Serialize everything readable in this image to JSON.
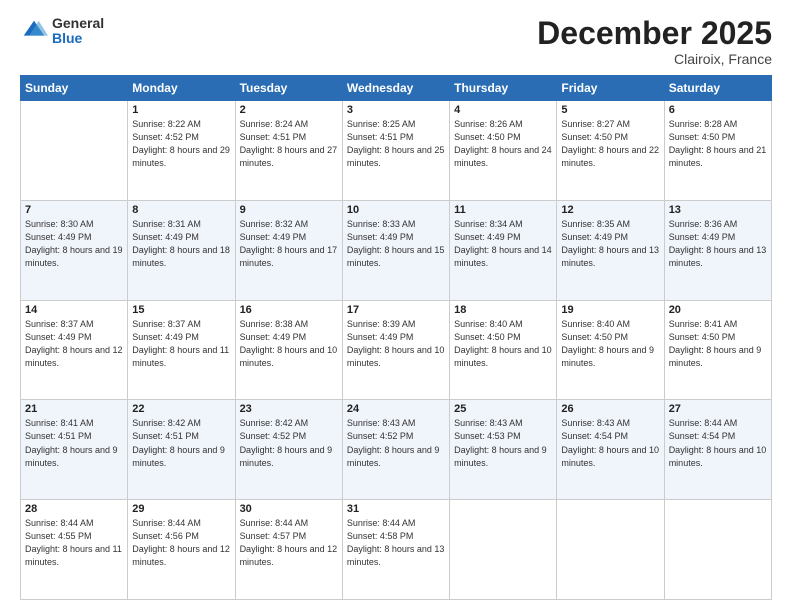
{
  "header": {
    "logo_general": "General",
    "logo_blue": "Blue",
    "month": "December 2025",
    "location": "Clairoix, France"
  },
  "days_of_week": [
    "Sunday",
    "Monday",
    "Tuesday",
    "Wednesday",
    "Thursday",
    "Friday",
    "Saturday"
  ],
  "weeks": [
    [
      {
        "day": "",
        "sunrise": "",
        "sunset": "",
        "daylight": "",
        "empty": true
      },
      {
        "day": "1",
        "sunrise": "Sunrise: 8:22 AM",
        "sunset": "Sunset: 4:52 PM",
        "daylight": "Daylight: 8 hours and 29 minutes."
      },
      {
        "day": "2",
        "sunrise": "Sunrise: 8:24 AM",
        "sunset": "Sunset: 4:51 PM",
        "daylight": "Daylight: 8 hours and 27 minutes."
      },
      {
        "day": "3",
        "sunrise": "Sunrise: 8:25 AM",
        "sunset": "Sunset: 4:51 PM",
        "daylight": "Daylight: 8 hours and 25 minutes."
      },
      {
        "day": "4",
        "sunrise": "Sunrise: 8:26 AM",
        "sunset": "Sunset: 4:50 PM",
        "daylight": "Daylight: 8 hours and 24 minutes."
      },
      {
        "day": "5",
        "sunrise": "Sunrise: 8:27 AM",
        "sunset": "Sunset: 4:50 PM",
        "daylight": "Daylight: 8 hours and 22 minutes."
      },
      {
        "day": "6",
        "sunrise": "Sunrise: 8:28 AM",
        "sunset": "Sunset: 4:50 PM",
        "daylight": "Daylight: 8 hours and 21 minutes."
      }
    ],
    [
      {
        "day": "7",
        "sunrise": "Sunrise: 8:30 AM",
        "sunset": "Sunset: 4:49 PM",
        "daylight": "Daylight: 8 hours and 19 minutes."
      },
      {
        "day": "8",
        "sunrise": "Sunrise: 8:31 AM",
        "sunset": "Sunset: 4:49 PM",
        "daylight": "Daylight: 8 hours and 18 minutes."
      },
      {
        "day": "9",
        "sunrise": "Sunrise: 8:32 AM",
        "sunset": "Sunset: 4:49 PM",
        "daylight": "Daylight: 8 hours and 17 minutes."
      },
      {
        "day": "10",
        "sunrise": "Sunrise: 8:33 AM",
        "sunset": "Sunset: 4:49 PM",
        "daylight": "Daylight: 8 hours and 15 minutes."
      },
      {
        "day": "11",
        "sunrise": "Sunrise: 8:34 AM",
        "sunset": "Sunset: 4:49 PM",
        "daylight": "Daylight: 8 hours and 14 minutes."
      },
      {
        "day": "12",
        "sunrise": "Sunrise: 8:35 AM",
        "sunset": "Sunset: 4:49 PM",
        "daylight": "Daylight: 8 hours and 13 minutes."
      },
      {
        "day": "13",
        "sunrise": "Sunrise: 8:36 AM",
        "sunset": "Sunset: 4:49 PM",
        "daylight": "Daylight: 8 hours and 13 minutes."
      }
    ],
    [
      {
        "day": "14",
        "sunrise": "Sunrise: 8:37 AM",
        "sunset": "Sunset: 4:49 PM",
        "daylight": "Daylight: 8 hours and 12 minutes."
      },
      {
        "day": "15",
        "sunrise": "Sunrise: 8:37 AM",
        "sunset": "Sunset: 4:49 PM",
        "daylight": "Daylight: 8 hours and 11 minutes."
      },
      {
        "day": "16",
        "sunrise": "Sunrise: 8:38 AM",
        "sunset": "Sunset: 4:49 PM",
        "daylight": "Daylight: 8 hours and 10 minutes."
      },
      {
        "day": "17",
        "sunrise": "Sunrise: 8:39 AM",
        "sunset": "Sunset: 4:49 PM",
        "daylight": "Daylight: 8 hours and 10 minutes."
      },
      {
        "day": "18",
        "sunrise": "Sunrise: 8:40 AM",
        "sunset": "Sunset: 4:50 PM",
        "daylight": "Daylight: 8 hours and 10 minutes."
      },
      {
        "day": "19",
        "sunrise": "Sunrise: 8:40 AM",
        "sunset": "Sunset: 4:50 PM",
        "daylight": "Daylight: 8 hours and 9 minutes."
      },
      {
        "day": "20",
        "sunrise": "Sunrise: 8:41 AM",
        "sunset": "Sunset: 4:50 PM",
        "daylight": "Daylight: 8 hours and 9 minutes."
      }
    ],
    [
      {
        "day": "21",
        "sunrise": "Sunrise: 8:41 AM",
        "sunset": "Sunset: 4:51 PM",
        "daylight": "Daylight: 8 hours and 9 minutes."
      },
      {
        "day": "22",
        "sunrise": "Sunrise: 8:42 AM",
        "sunset": "Sunset: 4:51 PM",
        "daylight": "Daylight: 8 hours and 9 minutes."
      },
      {
        "day": "23",
        "sunrise": "Sunrise: 8:42 AM",
        "sunset": "Sunset: 4:52 PM",
        "daylight": "Daylight: 8 hours and 9 minutes."
      },
      {
        "day": "24",
        "sunrise": "Sunrise: 8:43 AM",
        "sunset": "Sunset: 4:52 PM",
        "daylight": "Daylight: 8 hours and 9 minutes."
      },
      {
        "day": "25",
        "sunrise": "Sunrise: 8:43 AM",
        "sunset": "Sunset: 4:53 PM",
        "daylight": "Daylight: 8 hours and 9 minutes."
      },
      {
        "day": "26",
        "sunrise": "Sunrise: 8:43 AM",
        "sunset": "Sunset: 4:54 PM",
        "daylight": "Daylight: 8 hours and 10 minutes."
      },
      {
        "day": "27",
        "sunrise": "Sunrise: 8:44 AM",
        "sunset": "Sunset: 4:54 PM",
        "daylight": "Daylight: 8 hours and 10 minutes."
      }
    ],
    [
      {
        "day": "28",
        "sunrise": "Sunrise: 8:44 AM",
        "sunset": "Sunset: 4:55 PM",
        "daylight": "Daylight: 8 hours and 11 minutes."
      },
      {
        "day": "29",
        "sunrise": "Sunrise: 8:44 AM",
        "sunset": "Sunset: 4:56 PM",
        "daylight": "Daylight: 8 hours and 12 minutes."
      },
      {
        "day": "30",
        "sunrise": "Sunrise: 8:44 AM",
        "sunset": "Sunset: 4:57 PM",
        "daylight": "Daylight: 8 hours and 12 minutes."
      },
      {
        "day": "31",
        "sunrise": "Sunrise: 8:44 AM",
        "sunset": "Sunset: 4:58 PM",
        "daylight": "Daylight: 8 hours and 13 minutes."
      },
      {
        "day": "",
        "empty": true
      },
      {
        "day": "",
        "empty": true
      },
      {
        "day": "",
        "empty": true
      }
    ]
  ]
}
